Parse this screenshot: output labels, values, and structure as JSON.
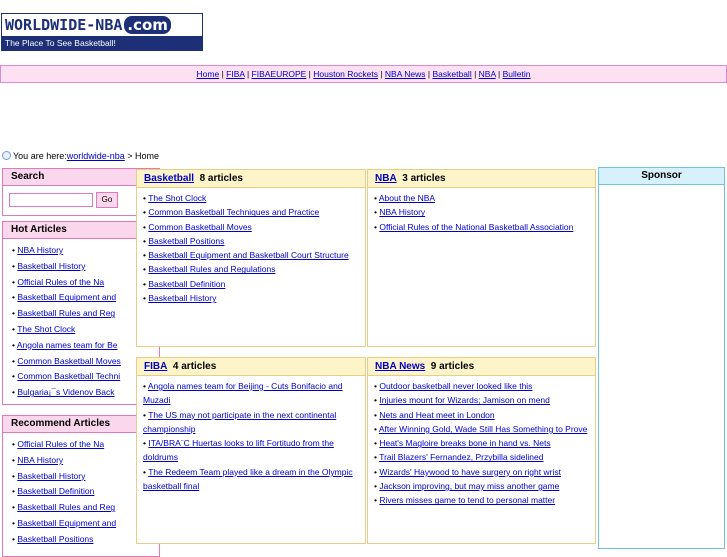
{
  "logo": {
    "brand": "WORLDWIDE-NBA",
    "com": ".com",
    "tagline": "The Place To See Basketball!"
  },
  "topnav": [
    "Home",
    "FIBA",
    "FIBAEUROPE",
    "Houston Rockets",
    "NBA News",
    "Basketball",
    "NBA",
    "Bulletin"
  ],
  "breadcrumb": {
    "prefix": "You are here:",
    "link": "worldwide-nba",
    "sep": " > ",
    "current": "Home"
  },
  "search": {
    "title": "Search",
    "placeholder": "",
    "button": "Go"
  },
  "hot_articles": {
    "title": "Hot Articles",
    "items": [
      "NBA History",
      "Basketball History",
      "Official Rules of the Na",
      "Basketball Equipment and",
      "Basketball Rules and Reg",
      "The Shot Clock",
      "Angola names team for Be",
      "Common Basketball Moves",
      "Common Basketball Techni",
      "Bulgaria¡¯s Videnov Back"
    ]
  },
  "recommend_articles": {
    "title": "Recommend Articles",
    "items": [
      "Official Rules of the Na",
      "NBA History",
      "Basketball History",
      "Basketball Definition",
      "Basketball Rules and Reg",
      "Basketball Equipment and",
      "Basketball Positions"
    ]
  },
  "sections": {
    "basketball": {
      "name": "Basketball",
      "count": "8 articles",
      "items": [
        "The Shot Clock",
        "Common Basketball Techniques and Practice",
        "Common Basketball Moves",
        "Basketball Positions",
        "Basketball Equipment and Basketball Court Structure",
        "Basketball Rules and Regulations",
        "Basketball Definition",
        "Basketball History"
      ]
    },
    "nba": {
      "name": "NBA",
      "count": "3 articles",
      "items": [
        "About the NBA",
        "NBA History",
        "Official Rules of the National Basketball Association"
      ]
    },
    "fiba": {
      "name": "FIBA",
      "count": "4 articles",
      "items": [
        "Angola names team for Beijing - Cuts Bonifacio and Muzadi",
        "The US may not participate in the next continental championship",
        "ITA/BRA¨C Huertas looks to lift Fortitudo from the doldrums",
        "The Redeem Team played like a dream in the Olympic basketball final"
      ]
    },
    "nbanews": {
      "name": "NBA News",
      "count": "9 articles",
      "items": [
        "Outdoor basketball never looked like this",
        "Injuries mount for Wizards; Jamison on mend",
        "Nets and Heat meet in London",
        "After Winning Gold, Wade Still Has Something to Prove",
        "Heat's Magloire breaks bone in hand vs. Nets",
        "Trail Blazers' Fernandez, Przybilla sidelined",
        "Wizards' Haywood to have surgery on right wrist",
        "Jackson improving, but may miss another game",
        "Rivers misses game to tend to personal matter"
      ]
    }
  },
  "sponsor": {
    "title": "Sponsor"
  }
}
